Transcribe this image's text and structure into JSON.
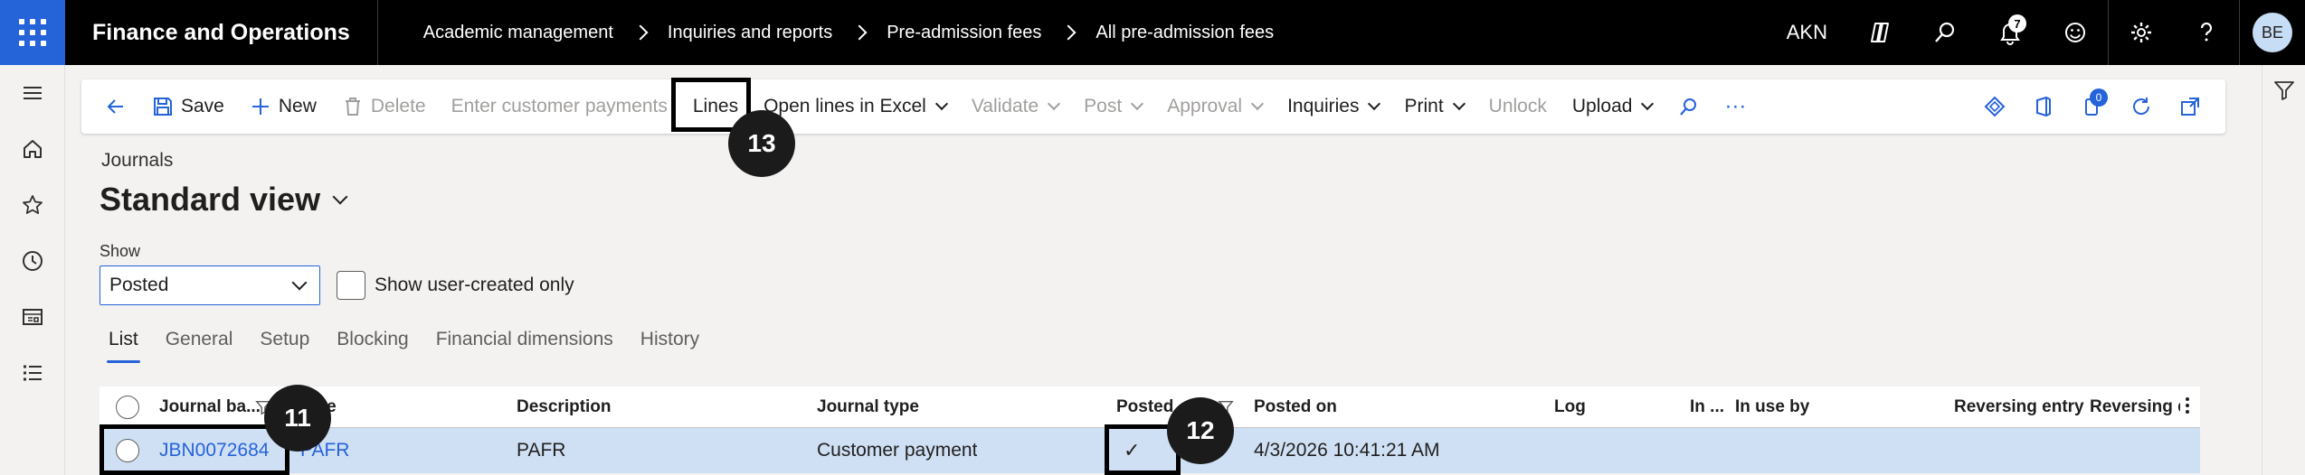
{
  "header": {
    "app_title": "Finance and Operations",
    "breadcrumbs": [
      "Academic management",
      "Inquiries and reports",
      "Pre-admission fees",
      "All pre-admission fees"
    ],
    "company": "AKN",
    "notification_count": "7",
    "user_initials": "BE"
  },
  "actions": {
    "save": "Save",
    "new": "New",
    "delete": "Delete",
    "enter_customer_payments": "Enter customer payments",
    "lines": "Lines",
    "open_lines_in_excel": "Open lines in Excel",
    "validate": "Validate",
    "post": "Post",
    "approval": "Approval",
    "inquiries": "Inquiries",
    "print": "Print",
    "unlock": "Unlock",
    "upload": "Upload",
    "more": "···",
    "attachments_count": "0"
  },
  "page": {
    "caption": "Journals",
    "view_title": "Standard view",
    "show_label": "Show",
    "show_value": "Posted",
    "user_created_label": "Show user-created only"
  },
  "tabs": [
    "List",
    "General",
    "Setup",
    "Blocking",
    "Financial dimensions",
    "History"
  ],
  "grid": {
    "columns": {
      "journal_batch": "Journal ba...",
      "name": "Name",
      "description": "Description",
      "journal_type": "Journal type",
      "posted": "Posted",
      "posted_on": "Posted on",
      "log": "Log",
      "in_use": "In ...",
      "in_use_by": "In use by",
      "reversing_entry": "Reversing entry",
      "reversing_date": "Reversing d"
    },
    "rows": [
      {
        "journal_batch": "JBN0072684",
        "name": "PAFR",
        "description": "PAFR",
        "journal_type": "Customer payment",
        "posted": "✓",
        "posted_on": "4/3/2026 10:41:21 AM"
      }
    ]
  },
  "callouts": {
    "c11": "11",
    "c12": "12",
    "c13": "13"
  },
  "colors": {
    "accent": "#2563d9",
    "topbar": "#000000",
    "selected_row": "#cfe0f5"
  }
}
